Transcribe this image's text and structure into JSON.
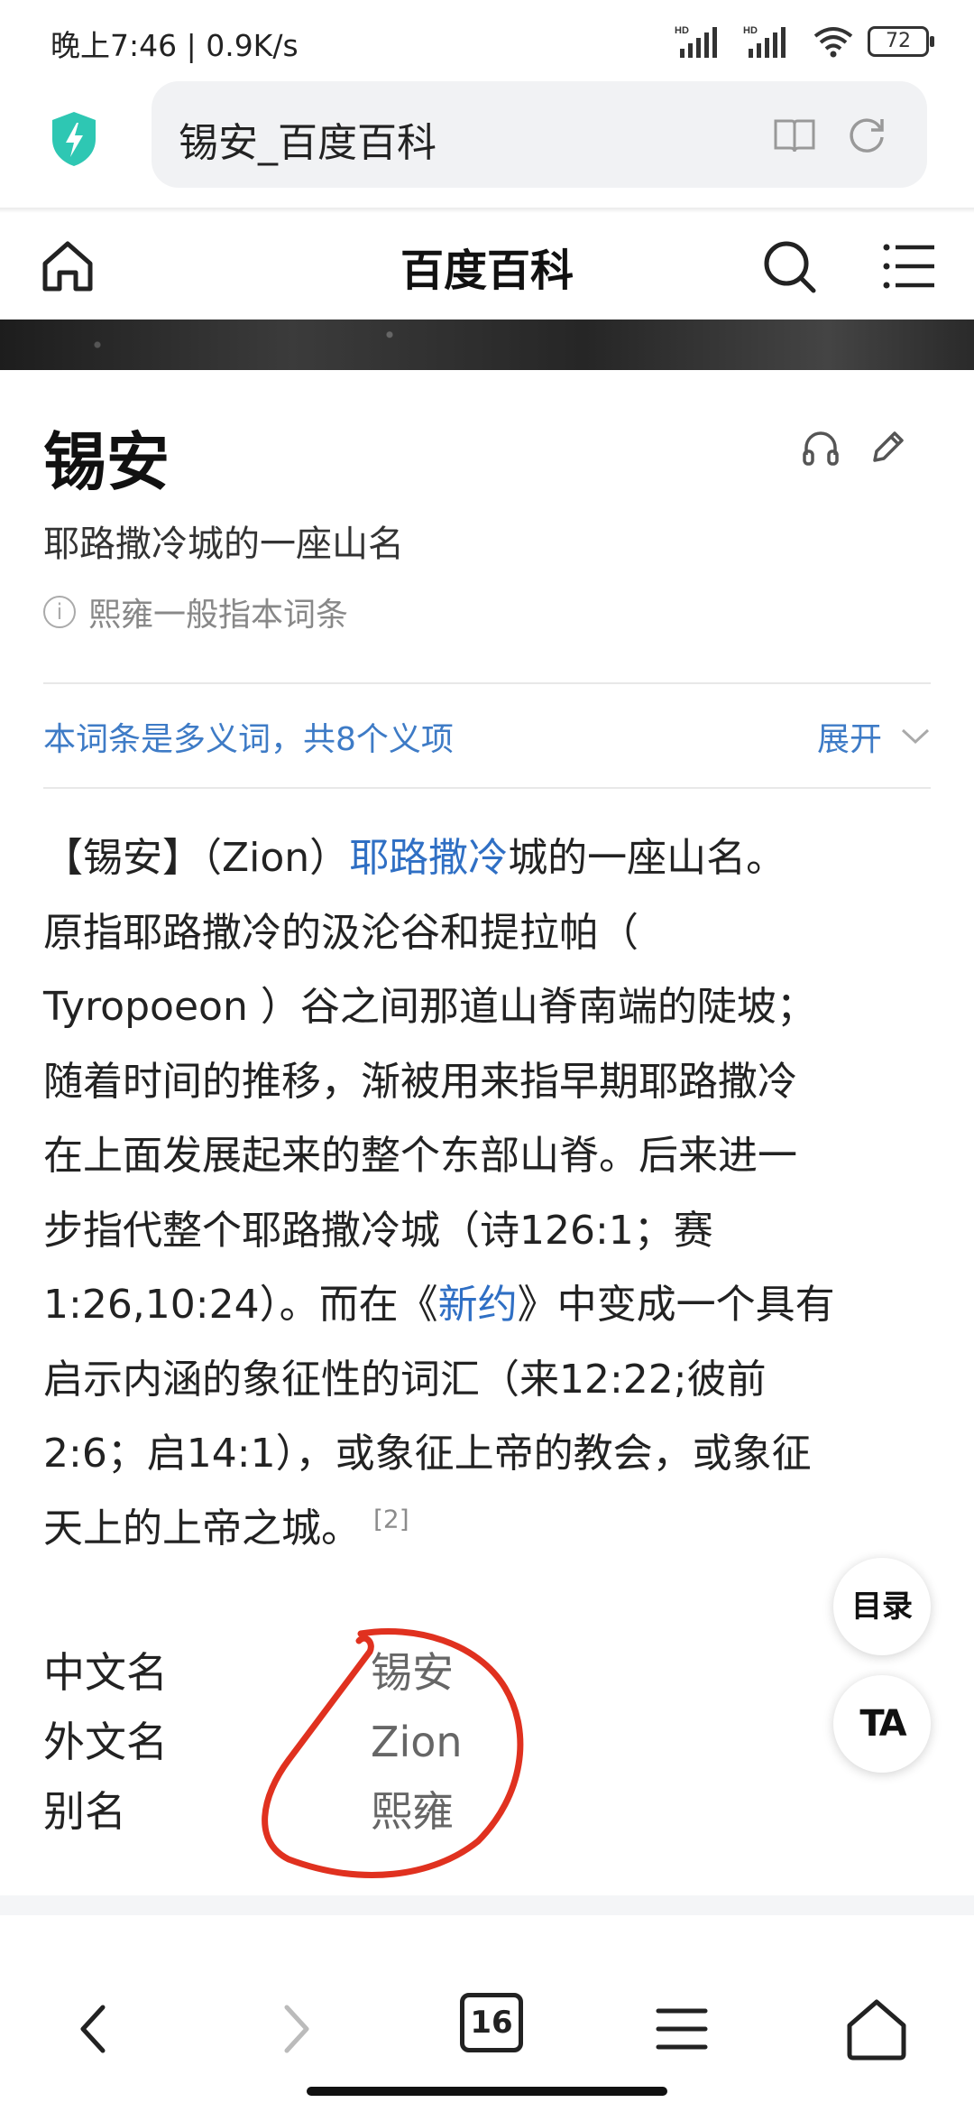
{
  "status_bar": {
    "time_speed": "晚上7:46 | 0.9K/s",
    "battery": "72",
    "signal_badge_1": "HD",
    "signal_badge_2": "HD"
  },
  "browser": {
    "url_title": "锡安_百度百科"
  },
  "baike_header": {
    "title": "百度百科"
  },
  "entry": {
    "title": "锡安",
    "subtitle": "耶路撒冷城的一座山名",
    "note": "熙雍一般指本词条",
    "polysemy": "本词条是多义词，共8个义项",
    "expand": "展开"
  },
  "paragraph": {
    "l1_a": "【锡安】（Zion）",
    "l1_link": "耶路撒冷",
    "l1_b": "城的一座山名。",
    "l2": "原指耶路撒冷的汲沦谷和提拉帕（",
    "l3": "Tyropoeon ）谷之间那道山脊南端的陡坡；",
    "l4": "随着时间的推移，渐被用来指早期耶路撒冷",
    "l5": "在上面发展起来的整个东部山脊。后来进一",
    "l6": "步指代整个耶路撒冷城（诗126:1；赛",
    "l7_a": "1:26,10:24）。而在《",
    "l7_link": "新约",
    "l7_b": "》中变成一个具有",
    "l8": "启示内涵的象征性的词汇（来12:22;彼前",
    "l9": "2:6；启14:1），或象征上帝的教会，或象征",
    "l10": "天上的上帝之城。",
    "ref": "[2]"
  },
  "infobox": [
    {
      "label": "中文名",
      "value": "锡安"
    },
    {
      "label": "外文名",
      "value": "Zion"
    },
    {
      "label": "别名",
      "value": "熙雍"
    }
  ],
  "floating": {
    "toc": "目录",
    "ta": "TA"
  },
  "bottom_nav": {
    "tab_count": "16"
  },
  "colors": {
    "link": "#2f6fc4",
    "polysemy": "#3e7bc6",
    "annotation": "#e0311f",
    "shield": "#2ec7b3"
  }
}
